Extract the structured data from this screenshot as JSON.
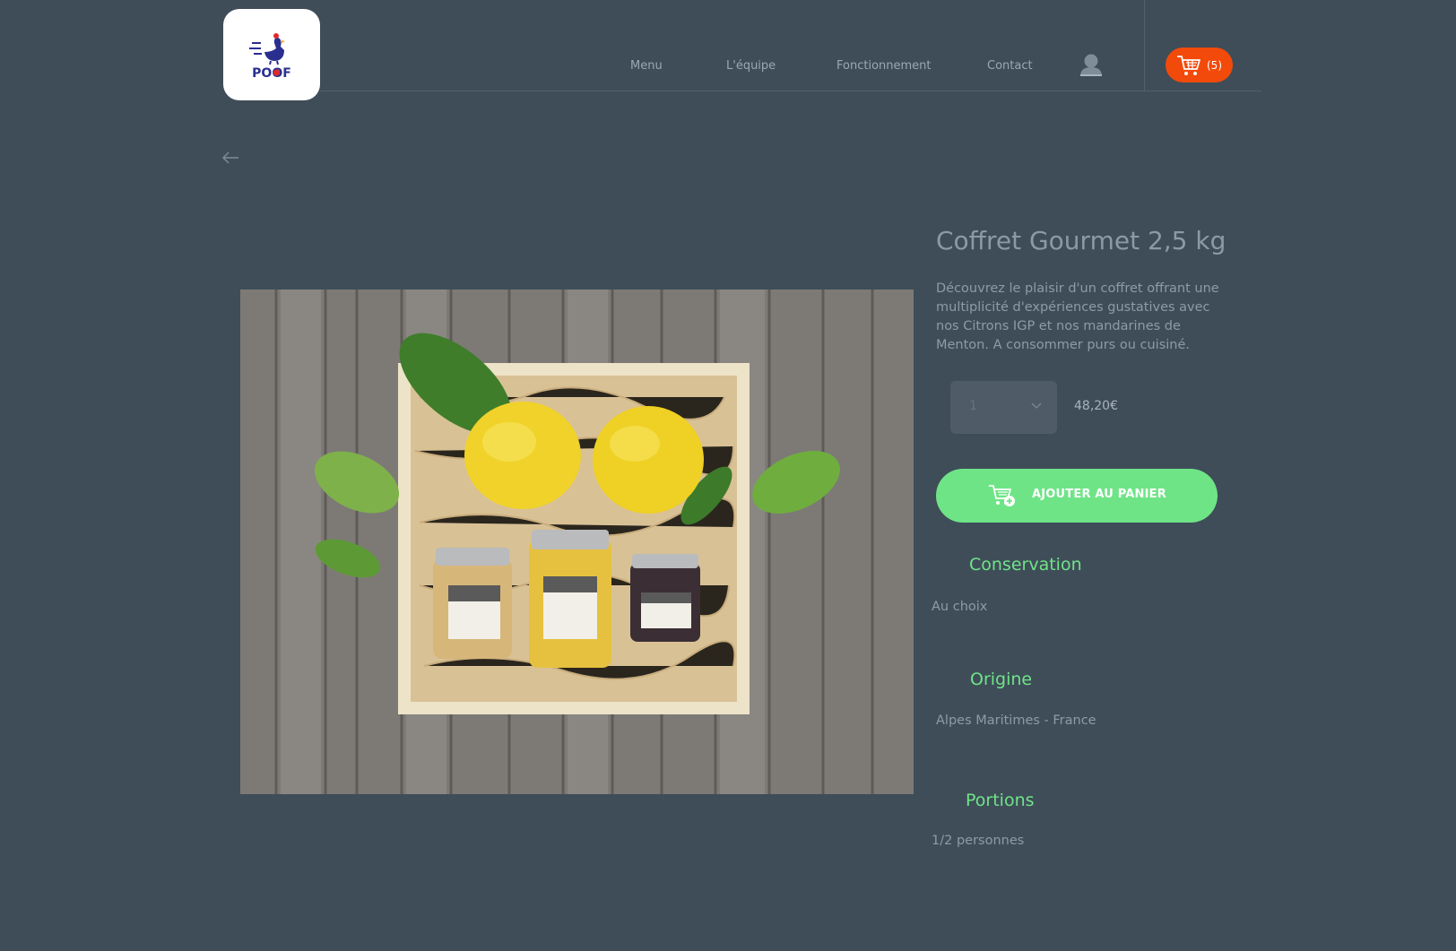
{
  "header": {
    "logo_text": "POOF",
    "nav": [
      "Menu",
      "L'équipe",
      "Fonctionnement",
      "Contact"
    ],
    "cart_count": "(5)",
    "icons": [
      "user-icon",
      "cart-icon"
    ]
  },
  "product": {
    "title": "Coffret Gourmet 2,5 kg",
    "description": "Découvrez le plaisir d'un coffret offrant une multiplicité d'expériences gustatives avec nos Citrons IGP et nos mandarines de Menton. A consommer purs ou cuisiné.",
    "quantity": "1",
    "price": "48,20€",
    "add_to_cart_label": "AJOUTER AU PANIER",
    "image_alt": "Coffret Gourmet"
  },
  "details": {
    "conservation": {
      "title": "Conservation",
      "value": "Au choix"
    },
    "origine": {
      "title": "Origine",
      "value": "Alpes Maritimes - France"
    },
    "portions": {
      "title": "Portions",
      "value": "1/2 personnes"
    }
  },
  "colors": {
    "background": "#3f4d59",
    "accent_green": "#6fe487",
    "cart_orange": "#f24a0a"
  }
}
